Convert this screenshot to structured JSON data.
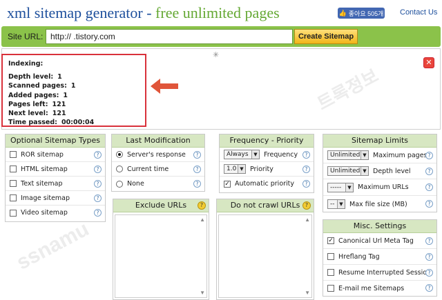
{
  "header": {
    "title_part1": "xml sitemap generator - ",
    "title_part2": "free unlimited pages",
    "fb_like": "좋아요 505개",
    "contact": "Contact Us"
  },
  "urlbar": {
    "label": "Site URL:",
    "value": "http://        .tistory.com",
    "button": "Create Sitemap"
  },
  "indexing": {
    "heading": "Indexing:",
    "rows": [
      {
        "label": "Depth level:",
        "value": "1"
      },
      {
        "label": "Scanned pages:",
        "value": "1"
      },
      {
        "label": "Added pages:",
        "value": "1"
      },
      {
        "label": "Pages left:",
        "value": "121"
      },
      {
        "label": "Next level:",
        "value": "121"
      },
      {
        "label": "Time passed:",
        "value": "00:00:04"
      }
    ]
  },
  "optional_types": {
    "title": "Optional Sitemap Types",
    "items": [
      "ROR sitemap",
      "HTML sitemap",
      "Text sitemap",
      "Image sitemap",
      "Video sitemap"
    ]
  },
  "last_modification": {
    "title": "Last Modification",
    "items": [
      {
        "label": "Server's response",
        "selected": true
      },
      {
        "label": "Current time",
        "selected": false
      },
      {
        "label": "None",
        "selected": false
      }
    ]
  },
  "frequency": {
    "title": "Frequency - Priority",
    "freq_value": "Always",
    "freq_label": "Frequency",
    "prio_value": "1.0",
    "prio_label": "Priority",
    "auto_label": "Automatic priority"
  },
  "limits": {
    "title": "Sitemap Limits",
    "rows": [
      {
        "value": "Unlimited",
        "label": "Maximum pages"
      },
      {
        "value": "Unlimited",
        "label": "Depth level"
      },
      {
        "value": "-----",
        "label": "Maximum URLs"
      },
      {
        "value": "--",
        "label": "Max file size (MB)"
      }
    ]
  },
  "exclude": {
    "title": "Exclude URLs"
  },
  "nocrawl": {
    "title": "Do not crawl URLs"
  },
  "misc": {
    "title": "Misc. Settings",
    "items": [
      {
        "label": "Canonical Url Meta Tag",
        "checked": true
      },
      {
        "label": "Hreflang Tag",
        "checked": false
      },
      {
        "label": "Resume Interrupted Session",
        "checked": false
      },
      {
        "label": "E-mail me Sitemaps",
        "checked": false
      }
    ]
  },
  "watermark_1": "ssnamu",
  "watermark_2": "트록정보",
  "colors": {
    "accent_green": "#8bc24a",
    "title_blue": "#1d4f9c",
    "highlight_red": "#d9303a",
    "arrow_orange": "#e0553a"
  }
}
